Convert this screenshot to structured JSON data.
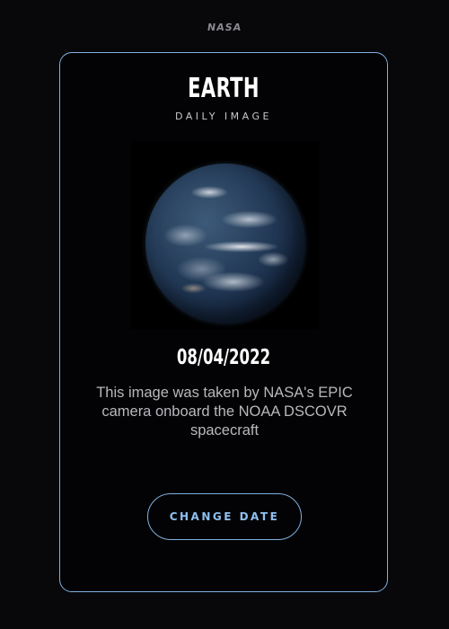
{
  "header": {
    "logo_text": "NASA"
  },
  "card": {
    "title": "EARTH",
    "subtitle": "DAILY IMAGE",
    "image": {
      "icon": "earth-globe-image"
    },
    "date": "08/04/2022",
    "description": "This image was taken by NASA's EPIC camera onboard the NOAA DSCOVR spacecraft",
    "change_date_label": "CHANGE DATE"
  },
  "colors": {
    "background": "#08080a",
    "accent": "#7fb0e0",
    "button_text": "#8fc0f0",
    "body_text": "#b8b8bd"
  }
}
